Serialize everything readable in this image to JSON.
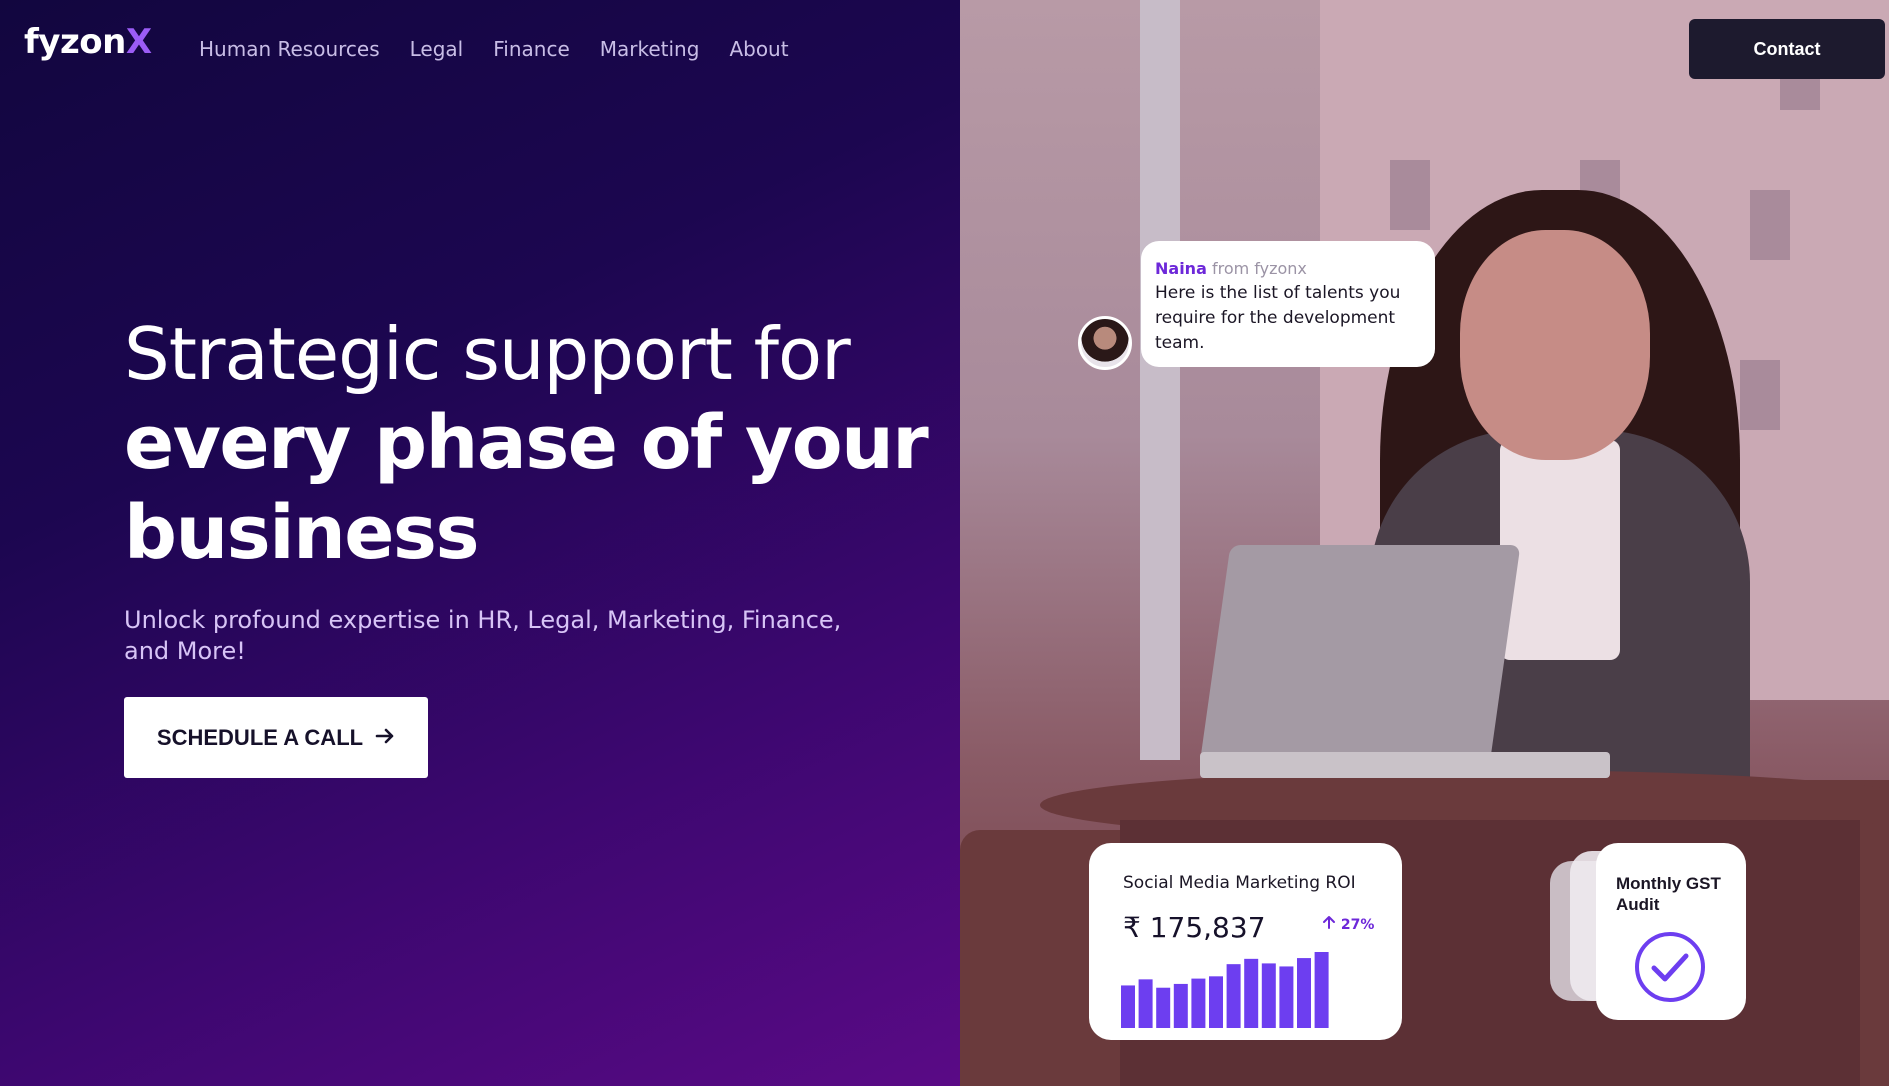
{
  "brand": {
    "logo_main": "fyzon",
    "logo_accent": "X"
  },
  "nav": {
    "items": [
      "Human Resources",
      "Legal",
      "Finance",
      "Marketing",
      "About"
    ]
  },
  "header": {
    "contact_label": "Contact"
  },
  "hero": {
    "line1": "Strategic support for",
    "line2": "every phase of your",
    "line3": "business",
    "subtitle": "Unlock profound expertise in HR, Legal, Marketing, Finance, and More!",
    "cta_label": "SCHEDULE A CALL",
    "cta_icon": "arrow-right-icon"
  },
  "chat": {
    "sender": "Naina",
    "from": "from fyzonx",
    "message": "Here is the list of talents you require for the development team."
  },
  "roi_card": {
    "title": "Social Media Marketing ROI",
    "value": "₹ 175,837",
    "change": "27%",
    "change_icon": "arrow-up-icon",
    "bar_values": [
      0.56,
      0.64,
      0.53,
      0.58,
      0.65,
      0.68,
      0.84,
      0.91,
      0.85,
      0.81,
      0.92,
      1.0
    ],
    "bar_color": "#6d3ef0"
  },
  "gst_card": {
    "title_line1": "Monthly GST",
    "title_line2": "Audit",
    "icon": "check-circle-icon",
    "accent": "#6d3ef0"
  },
  "colors": {
    "accent": "#9b5cf6",
    "dark": "#1d1a2e"
  }
}
